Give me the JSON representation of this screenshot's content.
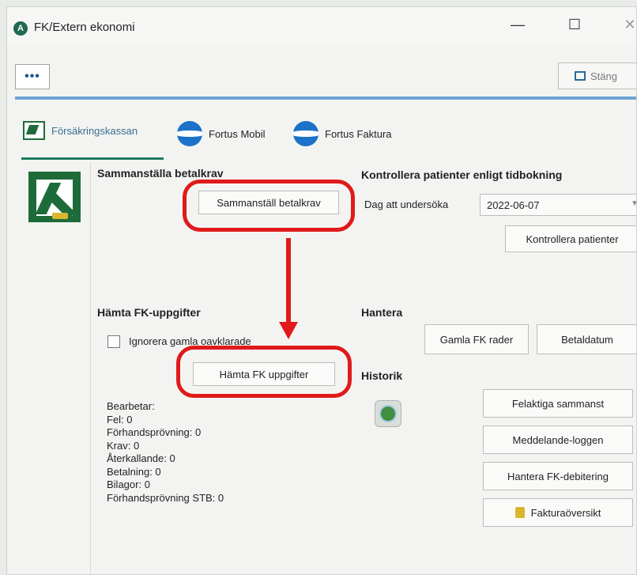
{
  "window": {
    "title": "FK/Extern ekonomi",
    "controls": {
      "minimize": "—",
      "maximize": "☐",
      "close": "✕"
    }
  },
  "toolbar": {
    "more_label": "•••",
    "close_label": "Stäng"
  },
  "tabs": [
    {
      "label": "Försäkringskassan",
      "active": true,
      "icon": "fk-logo-icon"
    },
    {
      "label": "Fortus Mobil",
      "icon": "globe-icon"
    },
    {
      "label": "Fortus Faktura",
      "icon": "globe-icon"
    }
  ],
  "sammanstalla": {
    "heading": "Sammanställa betalkrav",
    "button": "Sammanställ betalkrav"
  },
  "hamta": {
    "heading": "Hämta FK-uppgifter",
    "checkbox_label": "Ignorera gamla oavklarade",
    "button": "Hämta FK uppgifter"
  },
  "status": {
    "lines": [
      "Bearbetar:",
      "Fel: 0",
      "Förhandsprövning: 0",
      "Krav: 0",
      "Återkallande: 0",
      "Betalning: 0",
      "Bilagor: 0",
      "Förhandsprövning STB: 0"
    ]
  },
  "kontrollera": {
    "heading": "Kontrollera patienter enligt tidbokning",
    "date_label": "Dag att undersöka",
    "date_value": "2022-06-07",
    "button": "Kontrollera patienter"
  },
  "hantera": {
    "heading": "Hantera",
    "gamla_button": "Gamla FK rader",
    "betaldatum_button": "Betaldatum"
  },
  "historik": {
    "heading": "Historik",
    "buttons": [
      "Felaktiga sammanst",
      "Meddelande-loggen",
      "Hantera FK-debitering",
      "Fakturaöversikt"
    ]
  },
  "colors": {
    "annotation": "#e01a1a",
    "accent": "#6fa4d7",
    "brand_green": "#1e6b3a"
  }
}
